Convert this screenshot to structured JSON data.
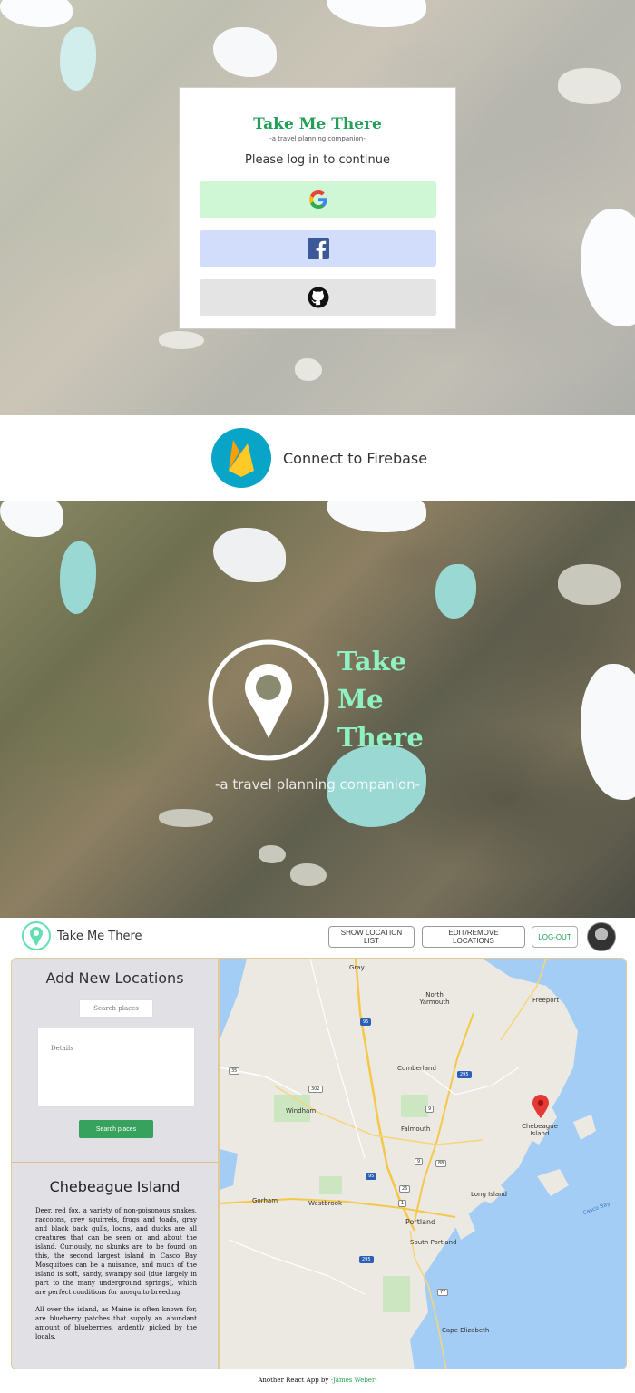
{
  "login": {
    "brand_title": "Take Me There",
    "brand_subtitle": "-a travel planning companion-",
    "prompt": "Please log in to continue",
    "providers": [
      {
        "name": "google-icon",
        "color": "#cff7d5"
      },
      {
        "name": "facebook-icon",
        "color": "#d1ddfb"
      },
      {
        "name": "github-icon",
        "color": "#e4e4e4"
      }
    ]
  },
  "firebase": {
    "label": "Connect to Firebase"
  },
  "splash": {
    "title_lines": [
      "Take",
      "Me",
      "There"
    ],
    "subtitle": "-a travel planning companion-"
  },
  "app": {
    "nav": {
      "title": "Take Me There",
      "show_list": "SHOW LOCATION LIST",
      "edit_remove": "EDIT/REMOVE LOCATIONS",
      "logout": "LOG-OUT"
    },
    "sidebar": {
      "heading": "Add New Locations",
      "search_placeholder": "Search places",
      "details_placeholder": "Details",
      "search_button": "Search places",
      "place_title": "Chebeague Island",
      "place_paragraphs": [
        "Deer, red fox, a variety of non-poisonous snakes, raccoons, grey squirrels, frogs and toads, gray and black back gulls, loons, and ducks are all creatures that can be seen on and about the island. Curiously, no skunks are to be found on this, the second largest island in Casco Bay Mosquitoes can be a nuisance, and much of the island is soft, sandy, swampy soil (due largely in part to the many underground springs), which are perfect conditions for mosquito breeding.",
        "All over the island, as Maine is often known for, are blueberry patches that supply an abundant amount of blueberries, ardently picked by the locals."
      ]
    },
    "map": {
      "labels": {
        "gray": "Gray",
        "north_yarmouth": "North Yarmouth",
        "freeport": "Freeport",
        "cumberland": "Cumberland",
        "windham": "Windham",
        "falmouth": "Falmouth",
        "chebeague": "Chebeague Island",
        "gorham": "Gorham",
        "westbrook": "Westbrook",
        "portland": "Portland",
        "south_portland": "South Portland",
        "long_island": "Long Island",
        "casco_bay": "Casco Bay",
        "cape_elizabeth": "Cape Elizabeth"
      },
      "shields": {
        "i95a": "95",
        "i95b": "95",
        "i295a": "295",
        "i295b": "295",
        "r35": "35",
        "r302": "302",
        "r9": "9",
        "r9b": "9",
        "r88": "88",
        "r26": "26",
        "r1": "1",
        "r77": "77"
      },
      "marker_color": "#e53935"
    },
    "footer": {
      "prefix": "Another React App by",
      "author": "-James Weber-"
    }
  }
}
